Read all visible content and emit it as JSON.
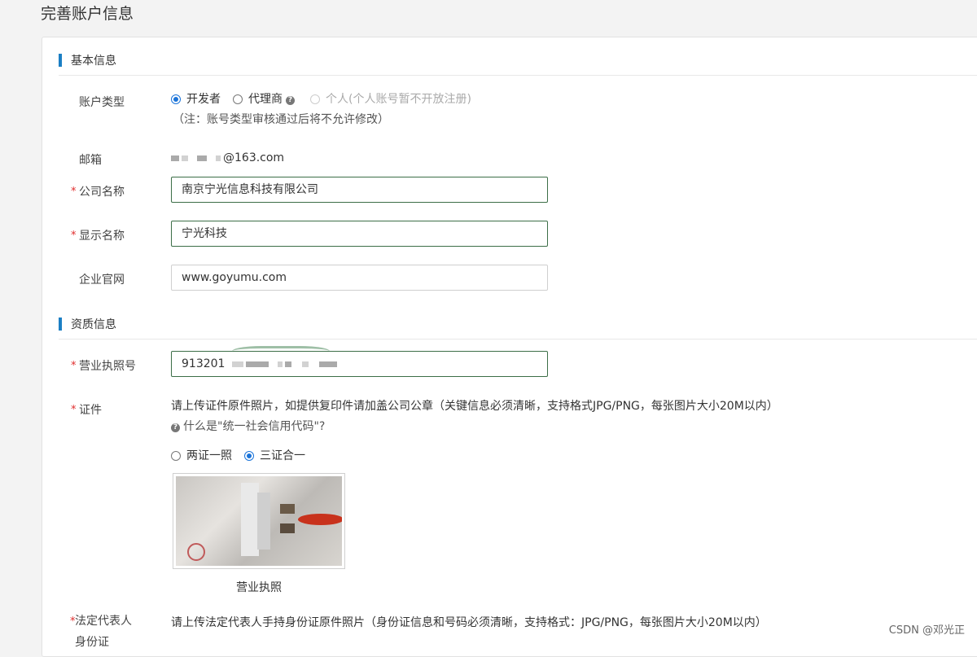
{
  "page": {
    "title": "完善账户信息"
  },
  "sections": {
    "basic": "基本信息",
    "qualification": "资质信息"
  },
  "account_type": {
    "label": "账户类型",
    "options": [
      {
        "label": "开发者",
        "selected": true
      },
      {
        "label": "代理商",
        "selected": false
      },
      {
        "label": "个人(个人账号暂不开放注册)",
        "selected": false,
        "disabled": true
      }
    ],
    "note": "（注：账号类型审核通过后将不允许修改）"
  },
  "email": {
    "label": "邮箱",
    "value_suffix": "@163.com"
  },
  "company_name": {
    "label": "公司名称",
    "value": "南京宁光信息科技有限公司"
  },
  "display_name": {
    "label": "显示名称",
    "value": "宁光科技"
  },
  "website": {
    "label": "企业官网",
    "value": "www.goyumu.com"
  },
  "license_no": {
    "label": "营业执照号",
    "value_visible": "913201"
  },
  "certificate": {
    "label": "证件",
    "instruction": "请上传证件原件照片，如提供复印件请加盖公司公章（关键信息必须清晰，支持格式JPG/PNG，每张图片大小20M以内）",
    "help_link": "什么是\"统一社会信用代码\"?",
    "options": [
      {
        "label": "两证一照",
        "selected": false
      },
      {
        "label": "三证合一",
        "selected": true
      }
    ],
    "image_caption": "营业执照"
  },
  "legal_rep": {
    "label": "法定代表人",
    "label2": "身份证",
    "instruction": "请上传法定代表人手持身份证原件照片（身份证信息和号码必须清晰，支持格式：JPG/PNG，每张图片大小20M以内）"
  },
  "required_mark": "*",
  "watermark": "CSDN @邓光正",
  "colors": {
    "accent": "#1b7fc4",
    "radio": "#1a73d9",
    "required": "#e02d2d",
    "input_border": "#3c6e47"
  }
}
